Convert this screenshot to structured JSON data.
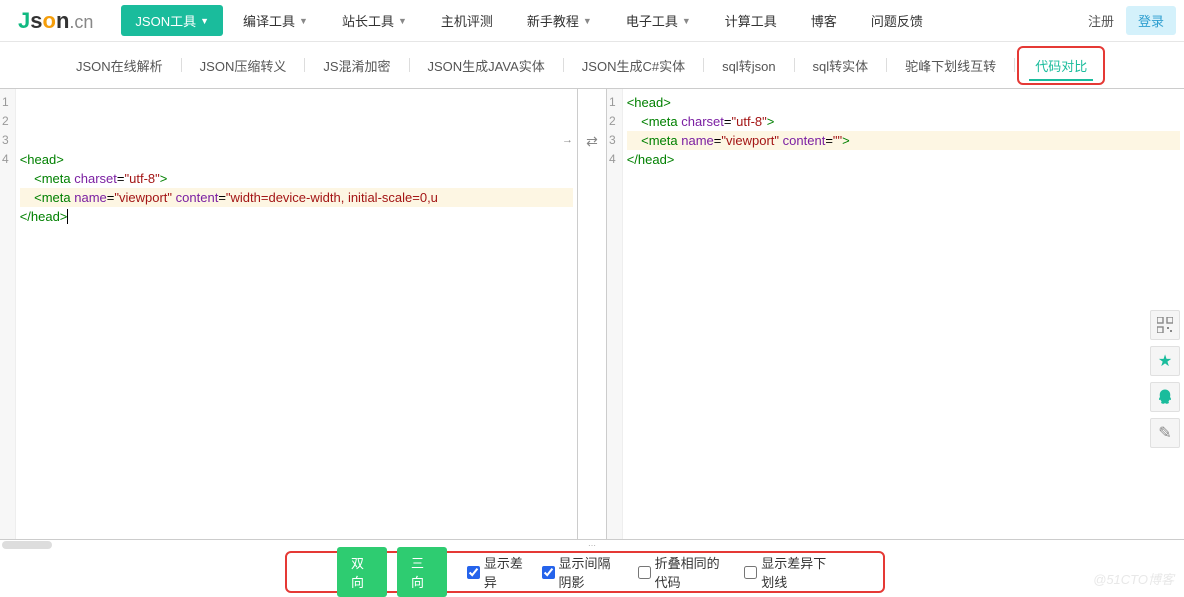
{
  "logo": {
    "j": "J",
    "s": "s",
    "o": "o",
    "n": "n",
    "cn": ".cn"
  },
  "nav": [
    {
      "label": "JSON工具",
      "primary": true,
      "caret": true
    },
    {
      "label": "编译工具",
      "caret": true
    },
    {
      "label": "站长工具",
      "caret": true
    },
    {
      "label": "主机评测"
    },
    {
      "label": "新手教程",
      "caret": true
    },
    {
      "label": "电子工具",
      "caret": true
    },
    {
      "label": "计算工具"
    },
    {
      "label": "博客"
    },
    {
      "label": "问题反馈"
    }
  ],
  "auth": {
    "register": "注册",
    "login": "登录"
  },
  "subnav": [
    "JSON在线解析",
    "JSON压缩转义",
    "JS混淆加密",
    "JSON生成JAVA实体",
    "JSON生成C#实体",
    "sql转json",
    "sql转实体",
    "驼峰下划线互转",
    "代码对比"
  ],
  "left": {
    "lines": [
      {
        "n": "1",
        "diff": false,
        "tokens": [
          {
            "t": "tag",
            "v": "<head>"
          }
        ]
      },
      {
        "n": "2",
        "diff": false,
        "tokens": [
          {
            "t": "plain",
            "v": "    "
          },
          {
            "t": "tag",
            "v": "<meta"
          },
          {
            "t": "plain",
            "v": " "
          },
          {
            "t": "attr",
            "v": "charset"
          },
          {
            "t": "plain",
            "v": "="
          },
          {
            "t": "str",
            "v": "\"utf-8\""
          },
          {
            "t": "tag",
            "v": ">"
          }
        ]
      },
      {
        "n": "3",
        "diff": true,
        "tokens": [
          {
            "t": "plain",
            "v": "    "
          },
          {
            "t": "tag",
            "v": "<meta"
          },
          {
            "t": "plain",
            "v": " "
          },
          {
            "t": "attr",
            "v": "name"
          },
          {
            "t": "plain",
            "v": "="
          },
          {
            "t": "str",
            "v": "\"viewport\""
          },
          {
            "t": "plain",
            "v": " "
          },
          {
            "t": "attr",
            "v": "content"
          },
          {
            "t": "plain",
            "v": "="
          },
          {
            "t": "str",
            "v": "\"width=device-width, initial-scale=0,u"
          }
        ]
      },
      {
        "n": "4",
        "diff": false,
        "tokens": [
          {
            "t": "tag",
            "v": "</head>"
          }
        ]
      }
    ],
    "arrow": "→"
  },
  "right": {
    "lines": [
      {
        "n": "1",
        "diff": false,
        "tokens": [
          {
            "t": "tag",
            "v": "<head>"
          }
        ]
      },
      {
        "n": "2",
        "diff": false,
        "tokens": [
          {
            "t": "plain",
            "v": "    "
          },
          {
            "t": "tag",
            "v": "<meta"
          },
          {
            "t": "plain",
            "v": " "
          },
          {
            "t": "attr",
            "v": "charset"
          },
          {
            "t": "plain",
            "v": "="
          },
          {
            "t": "str",
            "v": "\"utf-8\""
          },
          {
            "t": "tag",
            "v": ">"
          }
        ]
      },
      {
        "n": "3",
        "diff": true,
        "tokens": [
          {
            "t": "plain",
            "v": "    "
          },
          {
            "t": "tag",
            "v": "<meta"
          },
          {
            "t": "plain",
            "v": " "
          },
          {
            "t": "attr",
            "v": "name"
          },
          {
            "t": "plain",
            "v": "="
          },
          {
            "t": "str",
            "v": "\"viewport\""
          },
          {
            "t": "plain",
            "v": " "
          },
          {
            "t": "attr",
            "v": "content"
          },
          {
            "t": "plain",
            "v": "="
          },
          {
            "t": "str",
            "v": "\"\""
          },
          {
            "t": "tag",
            "v": ">"
          }
        ]
      },
      {
        "n": "4",
        "diff": false,
        "tokens": [
          {
            "t": "tag",
            "v": "</head>"
          }
        ]
      }
    ]
  },
  "splitter": "⇄",
  "toolbar": {
    "btn1": "双向",
    "btn2": "三向",
    "checks": [
      {
        "label": "显示差异",
        "checked": true
      },
      {
        "label": "显示间隔阴影",
        "checked": true
      },
      {
        "label": "折叠相同的代码",
        "checked": false
      },
      {
        "label": "显示差异下划线",
        "checked": false
      }
    ]
  },
  "sideicons": [
    "qr",
    "star",
    "qq",
    "pencil"
  ],
  "watermark": "@51CTO博客"
}
